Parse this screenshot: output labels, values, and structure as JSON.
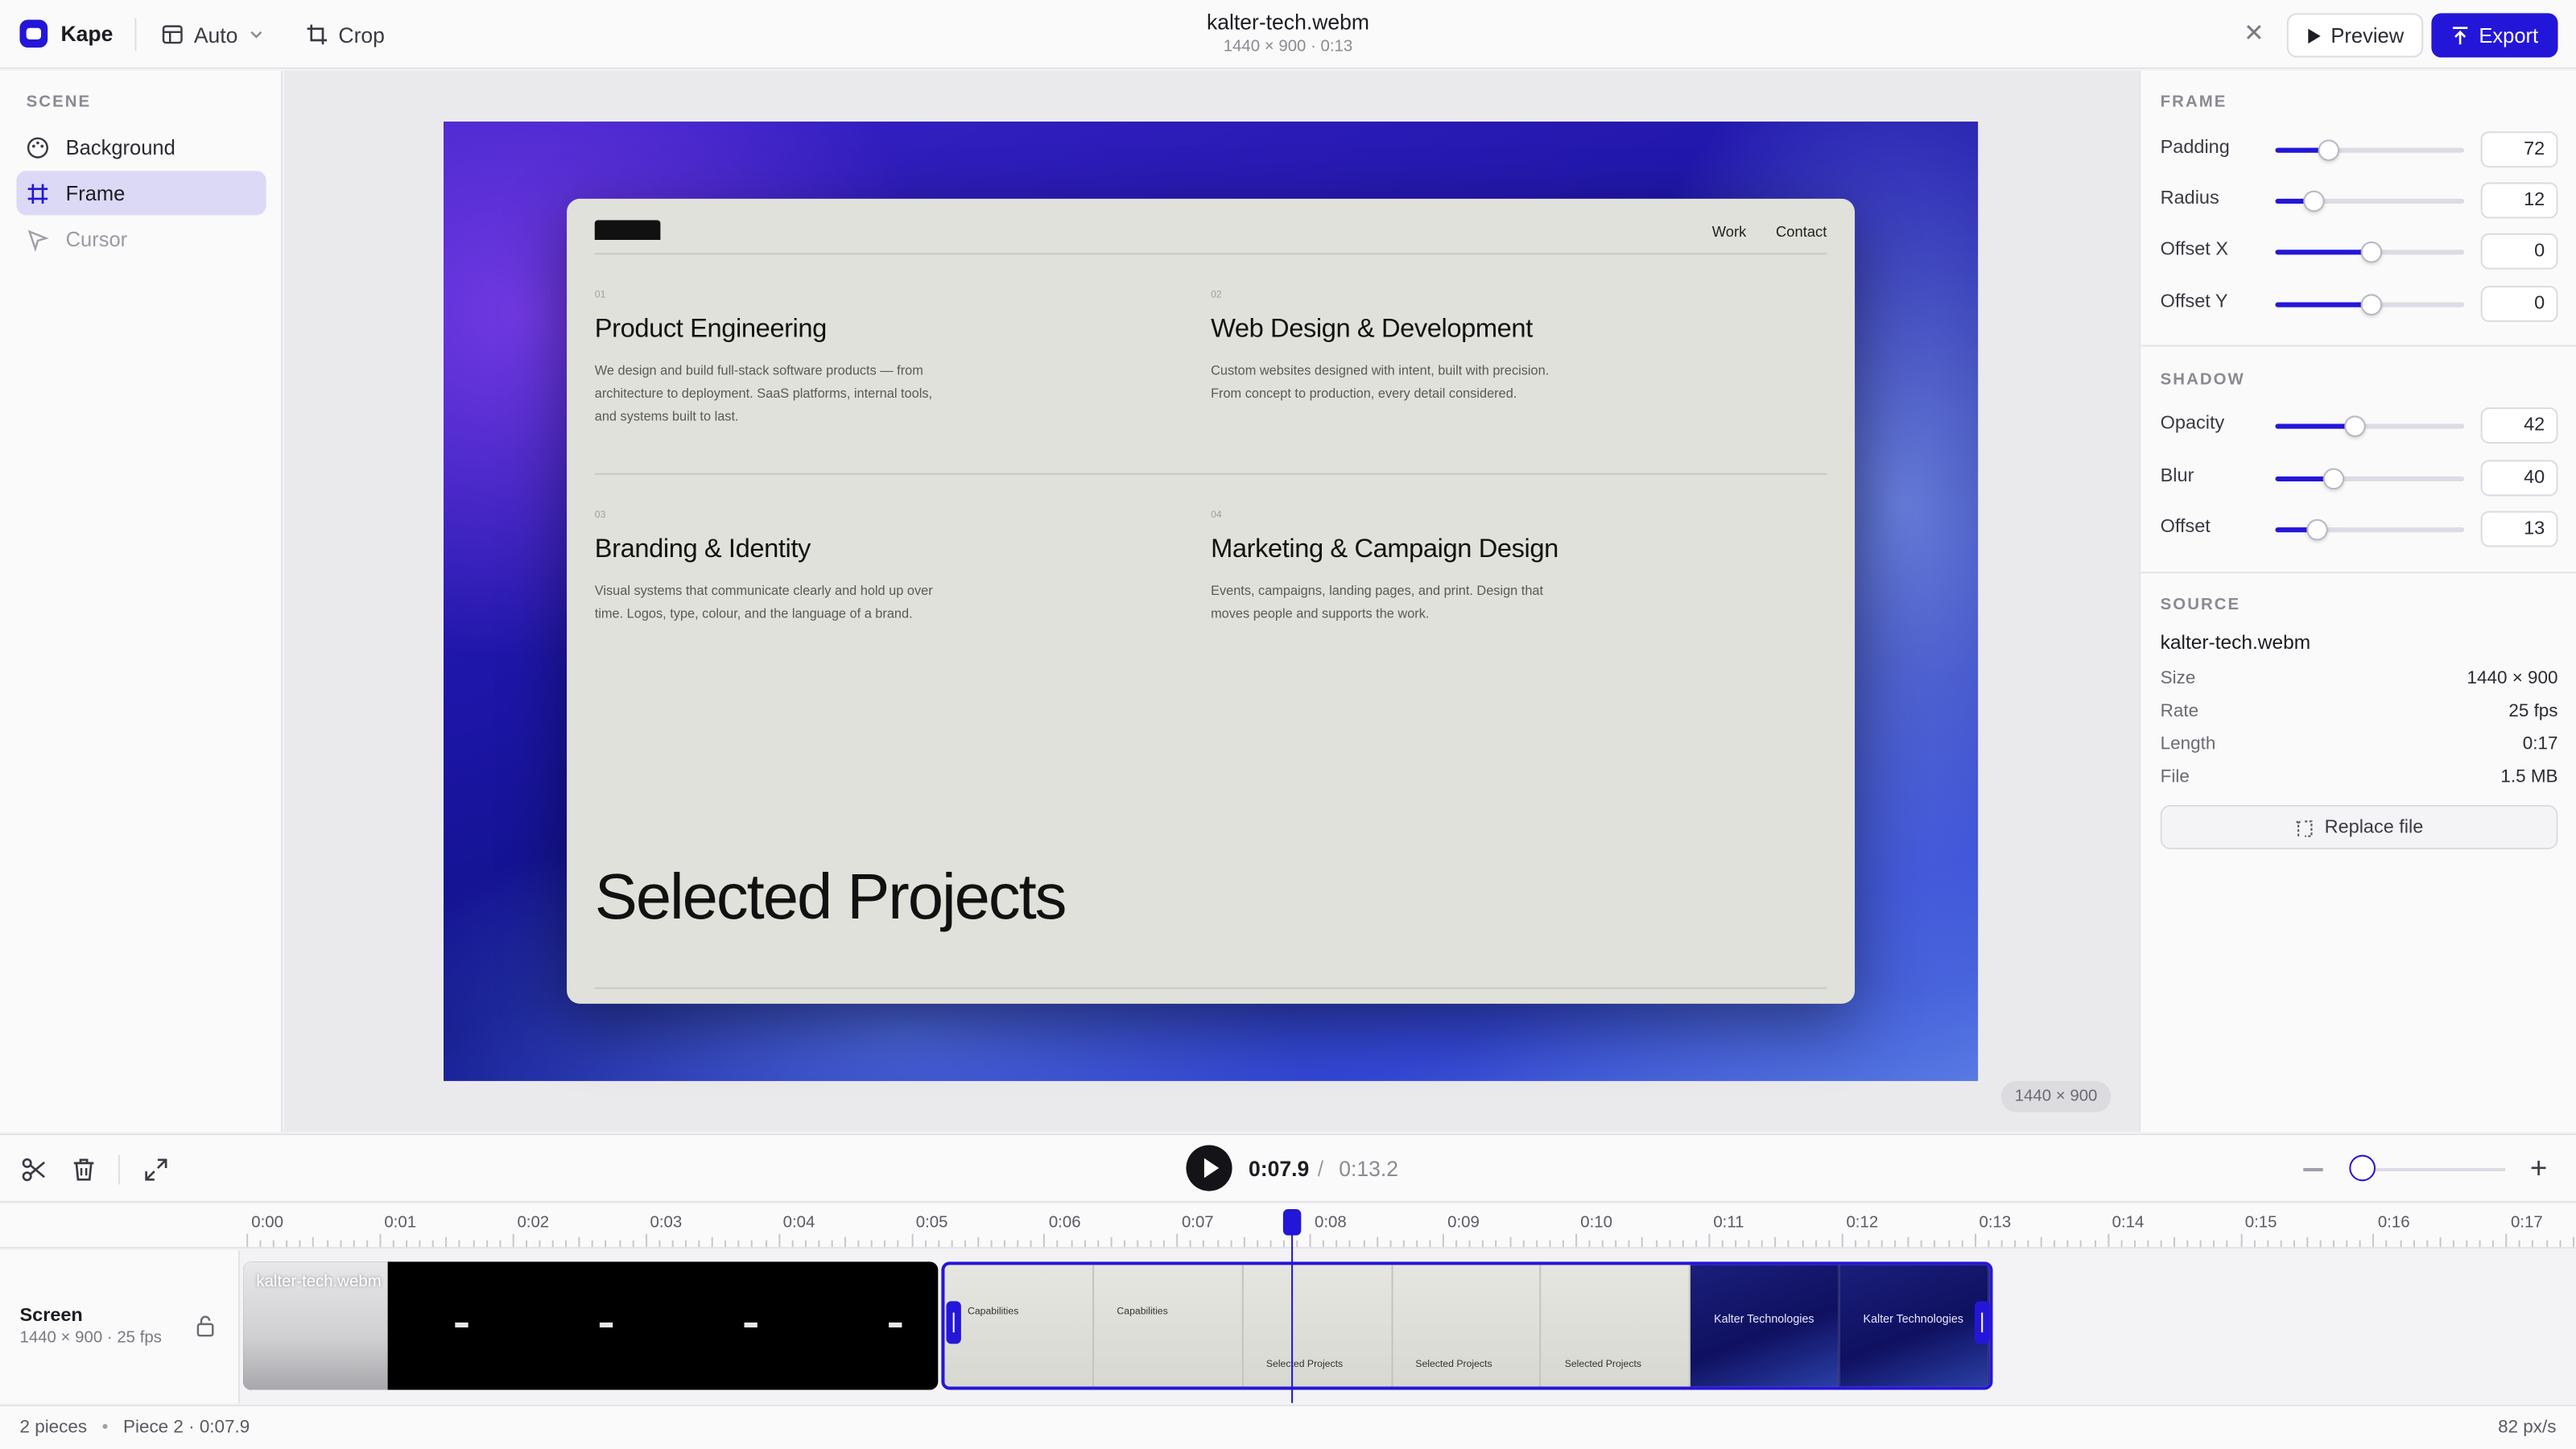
{
  "app": {
    "name": "Kape"
  },
  "toolbar": {
    "auto_label": "Auto",
    "crop_label": "Crop",
    "preview_label": "Preview",
    "export_label": "Export"
  },
  "file": {
    "title": "kalter-tech.webm",
    "subtitle": "1440 × 900 · 0:13"
  },
  "scene": {
    "section_label": "SCENE",
    "items": [
      {
        "label": "Background",
        "icon": "palette-icon",
        "state": "normal"
      },
      {
        "label": "Frame",
        "icon": "frame-grid-icon",
        "state": "active"
      },
      {
        "label": "Cursor",
        "icon": "cursor-icon",
        "state": "disabled"
      }
    ]
  },
  "canvas": {
    "badge": "1440 × 900",
    "card": {
      "nav": [
        "Work",
        "Contact"
      ],
      "services": [
        {
          "num": "01",
          "title": "Product Engineering",
          "desc": "We design and build full-stack software products — from architecture to deployment. SaaS platforms, internal tools, and systems built to last."
        },
        {
          "num": "02",
          "title": "Web Design & Development",
          "desc": "Custom websites designed with intent, built with precision. From concept to production, every detail considered."
        },
        {
          "num": "03",
          "title": "Branding & Identity",
          "desc": "Visual systems that communicate clearly and hold up over time. Logos, type, colour, and the language of a brand."
        },
        {
          "num": "04",
          "title": "Marketing & Campaign Design",
          "desc": "Events, campaigns, landing pages, and print. Design that moves people and supports the work."
        }
      ],
      "heading": "Selected Projects"
    }
  },
  "frame_panel": {
    "label": "FRAME",
    "controls": [
      {
        "label": "Padding",
        "value": "72",
        "fraction": 0.28
      },
      {
        "label": "Radius",
        "value": "12",
        "fraction": 0.2
      },
      {
        "label": "Offset X",
        "value": "0",
        "fraction": 0.5
      },
      {
        "label": "Offset Y",
        "value": "0",
        "fraction": 0.5
      }
    ]
  },
  "shadow_panel": {
    "label": "SHADOW",
    "controls": [
      {
        "label": "Opacity",
        "value": "42",
        "fraction": 0.42
      },
      {
        "label": "Blur",
        "value": "40",
        "fraction": 0.3
      },
      {
        "label": "Offset",
        "value": "13",
        "fraction": 0.22
      }
    ]
  },
  "source_panel": {
    "label": "SOURCE",
    "filename": "kalter-tech.webm",
    "fields": [
      {
        "key": "Size",
        "value": "1440 × 900"
      },
      {
        "key": "Rate",
        "value": "25 fps"
      },
      {
        "key": "Length",
        "value": "0:17"
      },
      {
        "key": "File",
        "value": "1.5 MB"
      }
    ],
    "replace_label": "Replace file"
  },
  "transport": {
    "current": "0:07.9",
    "separator": "/",
    "total": "0:13.2",
    "zoom_level": 0.0
  },
  "ruler": {
    "ticks": [
      "0:00",
      "0:01",
      "0:02",
      "0:03",
      "0:04",
      "0:05",
      "0:06",
      "0:07",
      "0:08",
      "0:09",
      "0:10",
      "0:11",
      "0:12",
      "0:13",
      "0:14",
      "0:15",
      "0:16",
      "0:17"
    ]
  },
  "track": {
    "name": "Screen",
    "sub": "1440 × 900 · 25 fps",
    "clip1_name": "kalter-tech.webm",
    "clip2_frames": [
      {
        "text": "Capabilities",
        "dark": false
      },
      {
        "text": "Capabilities",
        "dark": false
      },
      {
        "text": "Selected Projects",
        "dark": false
      },
      {
        "text": "Selected Projects",
        "dark": false
      },
      {
        "text": "Selected Projects",
        "dark": false
      },
      {
        "text": "Kalter Technologies",
        "dark": true
      },
      {
        "text": "Kalter Technologies",
        "dark": true
      }
    ]
  },
  "status": {
    "pieces": "2 pieces",
    "dot": "•",
    "piece_info": "Piece 2 · 0:07.9",
    "scale": "82 px/s"
  }
}
